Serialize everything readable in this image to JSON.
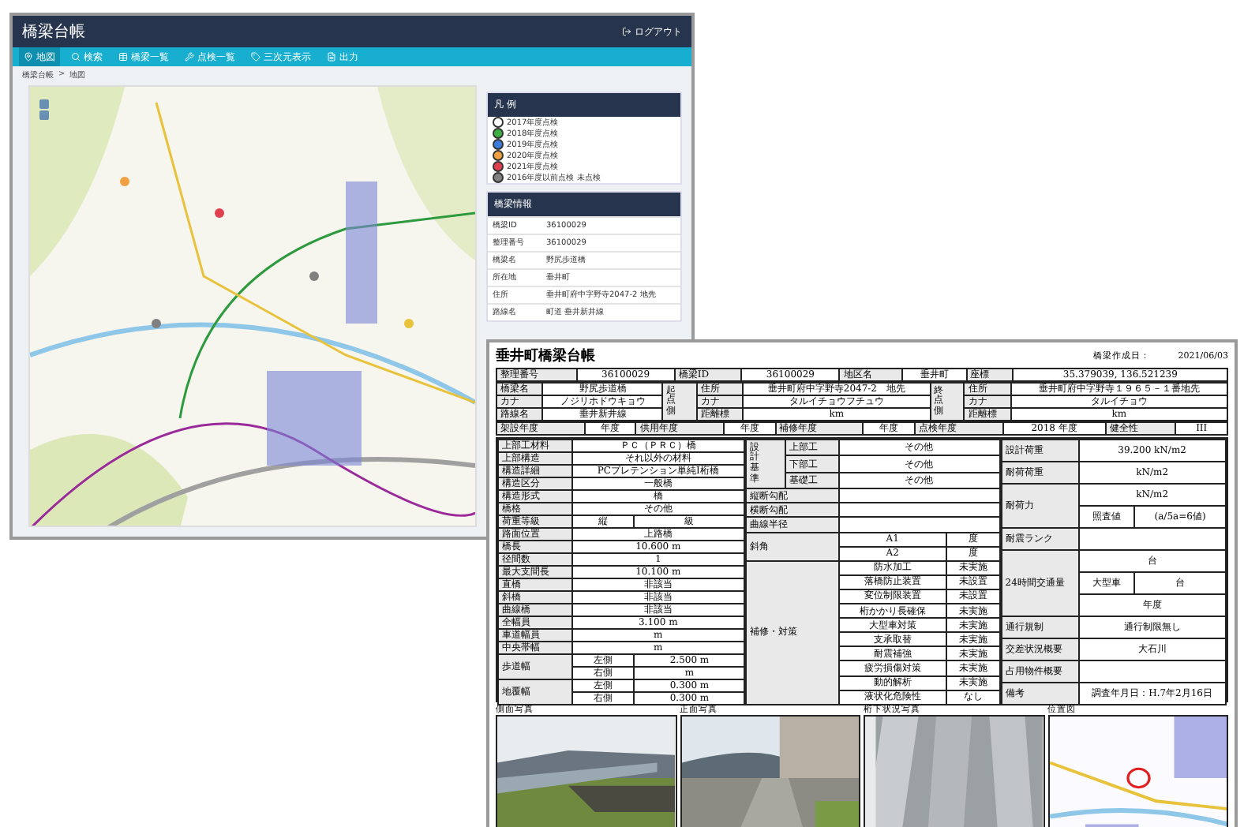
{
  "app": {
    "title": "橋梁台帳",
    "logout": "ログアウト",
    "nav": [
      {
        "label": "地図",
        "selected": true
      },
      {
        "label": "検索",
        "selected": false
      },
      {
        "label": "橋梁一覧",
        "selected": false
      },
      {
        "label": "点検一覧",
        "selected": false
      },
      {
        "label": "三次元表示",
        "selected": false
      },
      {
        "label": "出力",
        "selected": false
      }
    ],
    "breadcrumb": [
      "橋梁台帳",
      "地図"
    ],
    "breadcrumb_separator": ">",
    "legend": {
      "title": "凡 例",
      "items": [
        {
          "label": "2017年度点検",
          "color": "#ffffff"
        },
        {
          "label": "2018年度点検",
          "color": "#3cb043"
        },
        {
          "label": "2019年度点検",
          "color": "#3b7dd8"
        },
        {
          "label": "2020年度点検",
          "color": "#f0a040"
        },
        {
          "label": "2021年度点検",
          "color": "#e04050"
        },
        {
          "label": "2016年度以前点検 未点検",
          "color": "#808080"
        }
      ]
    },
    "info": {
      "title": "橋梁情報",
      "rows": [
        {
          "label": "橋梁ID",
          "value": "36100029"
        },
        {
          "label": "整理番号",
          "value": "36100029"
        },
        {
          "label": "橋梁名",
          "value": "野尻歩道橋"
        },
        {
          "label": "所在地",
          "value": "垂井町"
        },
        {
          "label": "住所",
          "value": "垂井町府中字野寺2047-2 地先"
        },
        {
          "label": "路線名",
          "value": "町道 垂井新井線"
        }
      ]
    }
  },
  "ledger": {
    "title": "垂井町橋梁台帳",
    "created_label": "橋梁作成日：",
    "created": "2021/06/03",
    "header_tables": [
      [
        [
          {
            "text": "整理番号",
            "head": true
          },
          {
            "text": "36100029"
          },
          {
            "text": "橋梁ID",
            "head": true
          },
          {
            "text": "36100029"
          },
          {
            "text": "地区名",
            "head": true
          },
          {
            "text": "垂井町"
          },
          {
            "text": "座標",
            "head": true
          },
          {
            "text": "35.379039, 136.521239"
          }
        ]
      ],
      [
        [
          {
            "text": "橋梁名",
            "head": true
          },
          {
            "text": "野尻歩道橋"
          },
          {
            "text": "起点側",
            "head": true,
            "vertical": true,
            "rowspan": 3
          },
          {
            "text": "住所",
            "head": true
          },
          {
            "text": "垂井町府中字野寺2047-2　地先"
          },
          {
            "text": "終点側",
            "head": true,
            "vertical": true,
            "rowspan": 3
          },
          {
            "text": "住所",
            "head": true
          },
          {
            "text": "垂井町府中字野寺１９６５－１番地先"
          }
        ],
        [
          {
            "text": "カナ",
            "head": true
          },
          {
            "text": "ノジリホドウキョウ"
          },
          {
            "text": "カナ",
            "head": true
          },
          {
            "text": "タルイチョウフチュウ"
          },
          {
            "text": "カナ",
            "head": true
          },
          {
            "text": "タルイチョウ"
          }
        ],
        [
          {
            "text": "路線名",
            "head": true
          },
          {
            "text": "垂井新井線"
          },
          {
            "text": "距離標",
            "head": true
          },
          {
            "text": "km"
          },
          {
            "text": "距離標",
            "head": true
          },
          {
            "text": "km"
          }
        ]
      ],
      [
        [
          {
            "text": "架設年度",
            "head": true
          },
          {
            "text": "年度"
          },
          {
            "text": "供用年度",
            "head": true
          },
          {
            "text": "年度"
          },
          {
            "text": "補修年度",
            "head": true
          },
          {
            "text": "年度"
          },
          {
            "text": "点検年度",
            "head": true
          },
          {
            "text": "2018 年度"
          },
          {
            "text": "健全性",
            "head": true
          },
          {
            "text": "III"
          }
        ]
      ]
    ],
    "body_tables": [
      [
        [
          {
            "text": "上部工材料",
            "head": true
          },
          {
            "text": "ＰＣ（ＰＲＣ）橋",
            "colspan": 2
          }
        ],
        [
          {
            "text": "上部構造",
            "head": true
          },
          {
            "text": "それ以外の材料",
            "colspan": 2
          }
        ],
        [
          {
            "text": "構造詳細",
            "head": true
          },
          {
            "text": "PCプレテンション単純I桁橋",
            "colspan": 2
          }
        ],
        [
          {
            "text": "構造区分",
            "head": true
          },
          {
            "text": "一般橋",
            "colspan": 2
          }
        ],
        [
          {
            "text": "構造形式",
            "head": true
          },
          {
            "text": "橋",
            "colspan": 2
          }
        ],
        [
          {
            "text": "橋格",
            "head": true
          },
          {
            "text": "その他",
            "colspan": 2
          }
        ],
        [
          {
            "text": "荷重等級",
            "head": true
          },
          {
            "text": "縦"
          },
          {
            "text": "級"
          }
        ],
        [
          {
            "text": "路面位置",
            "head": true
          },
          {
            "text": "上路橋",
            "colspan": 2
          }
        ],
        [
          {
            "text": "橋長",
            "head": true
          },
          {
            "text": "10.600 m",
            "colspan": 2
          }
        ],
        [
          {
            "text": "径間数",
            "head": true
          },
          {
            "text": "1",
            "colspan": 2
          }
        ],
        [
          {
            "text": "最大支間長",
            "head": true
          },
          {
            "text": "10.100 m",
            "colspan": 2
          }
        ],
        [
          {
            "text": "直橋",
            "head": true
          },
          {
            "text": "非該当",
            "colspan": 2
          }
        ],
        [
          {
            "text": "斜橋",
            "head": true
          },
          {
            "text": "非該当",
            "colspan": 2
          }
        ],
        [
          {
            "text": "曲線橋",
            "head": true
          },
          {
            "text": "非該当",
            "colspan": 2
          }
        ],
        [
          {
            "text": "全幅員",
            "head": true
          },
          {
            "text": "3.100 m",
            "colspan": 2
          }
        ],
        [
          {
            "text": "車道幅員",
            "head": true
          },
          {
            "text": "m",
            "colspan": 2
          }
        ],
        [
          {
            "text": "中央帯幅",
            "head": true
          },
          {
            "text": "m",
            "colspan": 2
          }
        ],
        [
          {
            "text": "歩道幅",
            "head": true,
            "rowspan": 2
          },
          {
            "text": "左側"
          },
          {
            "text": "2.500 m"
          }
        ],
        [
          {
            "text": "右側"
          },
          {
            "text": "m"
          }
        ],
        [
          {
            "text": "地覆幅",
            "head": true,
            "rowspan": 2
          },
          {
            "text": "左側"
          },
          {
            "text": "0.300 m"
          }
        ],
        [
          {
            "text": "右側"
          },
          {
            "text": "0.300 m"
          }
        ]
      ],
      [
        [
          {
            "text": "設計基準",
            "head": true,
            "vertical": true,
            "rowspan": 3
          },
          {
            "text": "上部工",
            "head": true
          },
          {
            "text": "その他",
            "colspan": 2
          }
        ],
        [
          {
            "text": "下部工",
            "head": true
          },
          {
            "text": "その他",
            "colspan": 2
          }
        ],
        [
          {
            "text": "基礎工",
            "head": true
          },
          {
            "text": "その他",
            "colspan": 2
          }
        ],
        [
          {
            "text": "縦断勾配",
            "head": true,
            "colspan": 2
          },
          {
            "colspan": 2
          }
        ],
        [
          {
            "text": "横断勾配",
            "head": true,
            "colspan": 2
          },
          {
            "colspan": 2
          }
        ],
        [
          {
            "text": "曲線半径",
            "head": true,
            "colspan": 2
          },
          {
            "colspan": 2
          }
        ],
        [
          {
            "text": "斜角",
            "head": true,
            "colspan": 2,
            "rowspan": 2
          },
          {
            "text": "A1"
          },
          {
            "text": "度"
          }
        ],
        [
          {
            "text": "A2"
          },
          {
            "text": "度"
          }
        ],
        [
          {
            "text": "補修・対策",
            "head": true,
            "colspan": 2,
            "rowspan": 10
          },
          {
            "text": "防水加工"
          },
          {
            "text": "未実施"
          }
        ],
        [
          {
            "text": "落橋防止装置"
          },
          {
            "text": "未設置"
          }
        ],
        [
          {
            "text": "変位制限装置"
          },
          {
            "text": "未設置"
          }
        ],
        [
          {
            "text": "桁かかり長確保"
          },
          {
            "text": "未実施"
          }
        ],
        [
          {
            "text": "大型車対策"
          },
          {
            "text": "未実施"
          }
        ],
        [
          {
            "text": "支承取替"
          },
          {
            "text": "未実施"
          }
        ],
        [
          {
            "text": "耐震補強"
          },
          {
            "text": "未実施"
          }
        ],
        [
          {
            "text": "疲労損傷対策"
          },
          {
            "text": "未実施"
          }
        ],
        [
          {
            "text": "動的解析"
          },
          {
            "text": "未実施"
          }
        ],
        [
          {
            "text": "液状化危険性"
          },
          {
            "text": "なし"
          }
        ]
      ],
      [
        [
          {
            "text": "設計荷重",
            "head": true
          },
          {
            "text": "39.200 kN/m2",
            "colspan": 2
          }
        ],
        [
          {
            "text": "耐荷荷重",
            "head": true
          },
          {
            "text": "kN/m2",
            "colspan": 2
          }
        ],
        [
          {
            "text": "耐荷力",
            "head": true,
            "rowspan": 2
          },
          {
            "text": "kN/m2",
            "colspan": 2
          }
        ],
        [
          {
            "text": "照査値"
          },
          {
            "text": "(a/5a=6値)"
          }
        ],
        [
          {
            "text": "耐震ランク",
            "head": true
          },
          {
            "colspan": 2
          }
        ],
        [
          {
            "text": "24時間交通量",
            "head": true,
            "rowspan": 3
          },
          {
            "text": "台",
            "colspan": 2
          }
        ],
        [
          {
            "text": "大型車"
          },
          {
            "text": "台"
          }
        ],
        [
          {
            "text": "年度",
            "colspan": 2
          }
        ],
        [
          {
            "text": "通行規制",
            "head": true
          },
          {
            "text": "通行制限無し",
            "colspan": 2
          }
        ],
        [
          {
            "text": "交差状況概要",
            "head": true
          },
          {
            "text": "大石川",
            "colspan": 2
          }
        ],
        [
          {
            "text": "占用物件概要",
            "head": true
          },
          {
            "colspan": 2
          }
        ],
        [
          {
            "text": "備考",
            "head": true
          },
          {
            "text": "調査年月日：H.7年2月16日",
            "colspan": 2
          }
        ]
      ]
    ],
    "photos": [
      {
        "caption": "側面写真",
        "kind": "picture"
      },
      {
        "caption": "正面写真",
        "kind": "picture"
      },
      {
        "caption": "桁下状況写真",
        "kind": "picture"
      },
      {
        "caption": "位置図",
        "kind": "picture"
      }
    ]
  }
}
